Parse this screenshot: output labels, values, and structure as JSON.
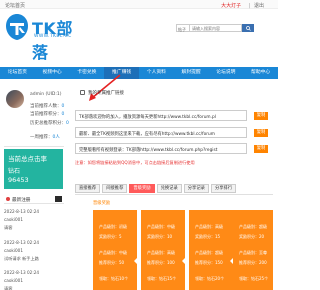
{
  "topbar": {
    "greeting": "论坛首页",
    "user": "大大灯子",
    "separator": "|",
    "logout": "退出"
  },
  "logo": {
    "text": "TK部落",
    "url": "WWW.TKBL.CC"
  },
  "search": {
    "select": "帖子",
    "placeholder": "请输入搜索内容",
    "button_icon": "search-icon"
  },
  "nav": [
    {
      "label": "论坛首页",
      "active": false
    },
    {
      "label": "视频中心",
      "active": false
    },
    {
      "label": "卡密兑换",
      "active": false
    },
    {
      "label": "推广赚钱",
      "active": true
    },
    {
      "label": "个人资料",
      "active": false
    },
    {
      "label": "解封提醒",
      "active": false
    },
    {
      "label": "论坛说明",
      "active": false
    },
    {
      "label": "帮助中心",
      "active": false
    }
  ],
  "sidebar": {
    "username": "admin (UID:1)",
    "lines": [
      {
        "label": "当前推荐人数：",
        "value": "0"
      },
      {
        "label": "当前推荐积分：",
        "value": "0"
      },
      {
        "label": "历史总推荐积分：",
        "value": "0"
      },
      {
        "label": "一周推荐：",
        "value": "0人"
      }
    ],
    "teal": {
      "title": "当前总点击率",
      "coin_label": "钻石",
      "coin_value": "96453"
    },
    "recent_title": "最新注册",
    "recent": [
      {
        "time": "2022-8-13 02:24",
        "name": "caoki001"
      },
      {
        "time": "",
        "name": "请客"
      },
      {
        "time": "2022-8-13 02:24",
        "name": "caoki001"
      },
      {
        "time": "",
        "name": "试听请求 新手上路"
      },
      {
        "time": "2022-8-13 02:24",
        "name": "caoki001"
      },
      {
        "time": "",
        "name": "请客"
      }
    ]
  },
  "main": {
    "panel_title": "我的专属推广链接",
    "links": [
      "TK部落欢迎你的加入，播放资源每天更新http://www.tkbl.cc/forum.pl",
      "最新、最全TK视频到这里来下载，应有尽有http://www.tkbl.cc/forum",
      "完整版看所有视频登录：TK部落http://www.tkbl.cc/forum.php?regist"
    ],
    "copy_label": "复制",
    "note": "注意：如您将链接粘贴到QQ消息中，可点击链接后复制进行使用",
    "tabs": [
      {
        "label": "直接推荐",
        "active": false
      },
      {
        "label": "间接推荐",
        "active": false
      },
      {
        "label": "晋级奖励",
        "active": true
      },
      {
        "label": "兑换记录",
        "active": false
      },
      {
        "label": "分享记录",
        "active": false
      },
      {
        "label": "分享排行",
        "active": false
      }
    ],
    "section_title": "晋级奖励",
    "cards": [
      {
        "rank": "产品级别：初级",
        "reward": "奖励积分：5",
        "bonus": "产品级别：中级",
        "extra": "推荐积分：50",
        "total": "领取：钻石10个"
      },
      {
        "rank": "产品级别：中级",
        "reward": "奖励积分：10",
        "bonus": "产品级别：高级",
        "extra": "推荐积分：100",
        "total": "领取：钻石15个"
      },
      {
        "rank": "产品级别：高级",
        "reward": "奖励积分：15",
        "bonus": "产品级别：超级",
        "extra": "推荐积分：150",
        "total": "领取：钻石20个"
      },
      {
        "rank": "产品级别：超级",
        "reward": "奖励积分：20",
        "bonus": "产品级别：至尊",
        "extra": "推荐积分：200",
        "total": "领取：钻石25个"
      }
    ]
  },
  "colors": {
    "brand": "#1a87d6",
    "teal": "#23b4a0",
    "orange": "#ff8400",
    "tab_active": "#ff5a5a",
    "note_red": "#e62e2e"
  }
}
